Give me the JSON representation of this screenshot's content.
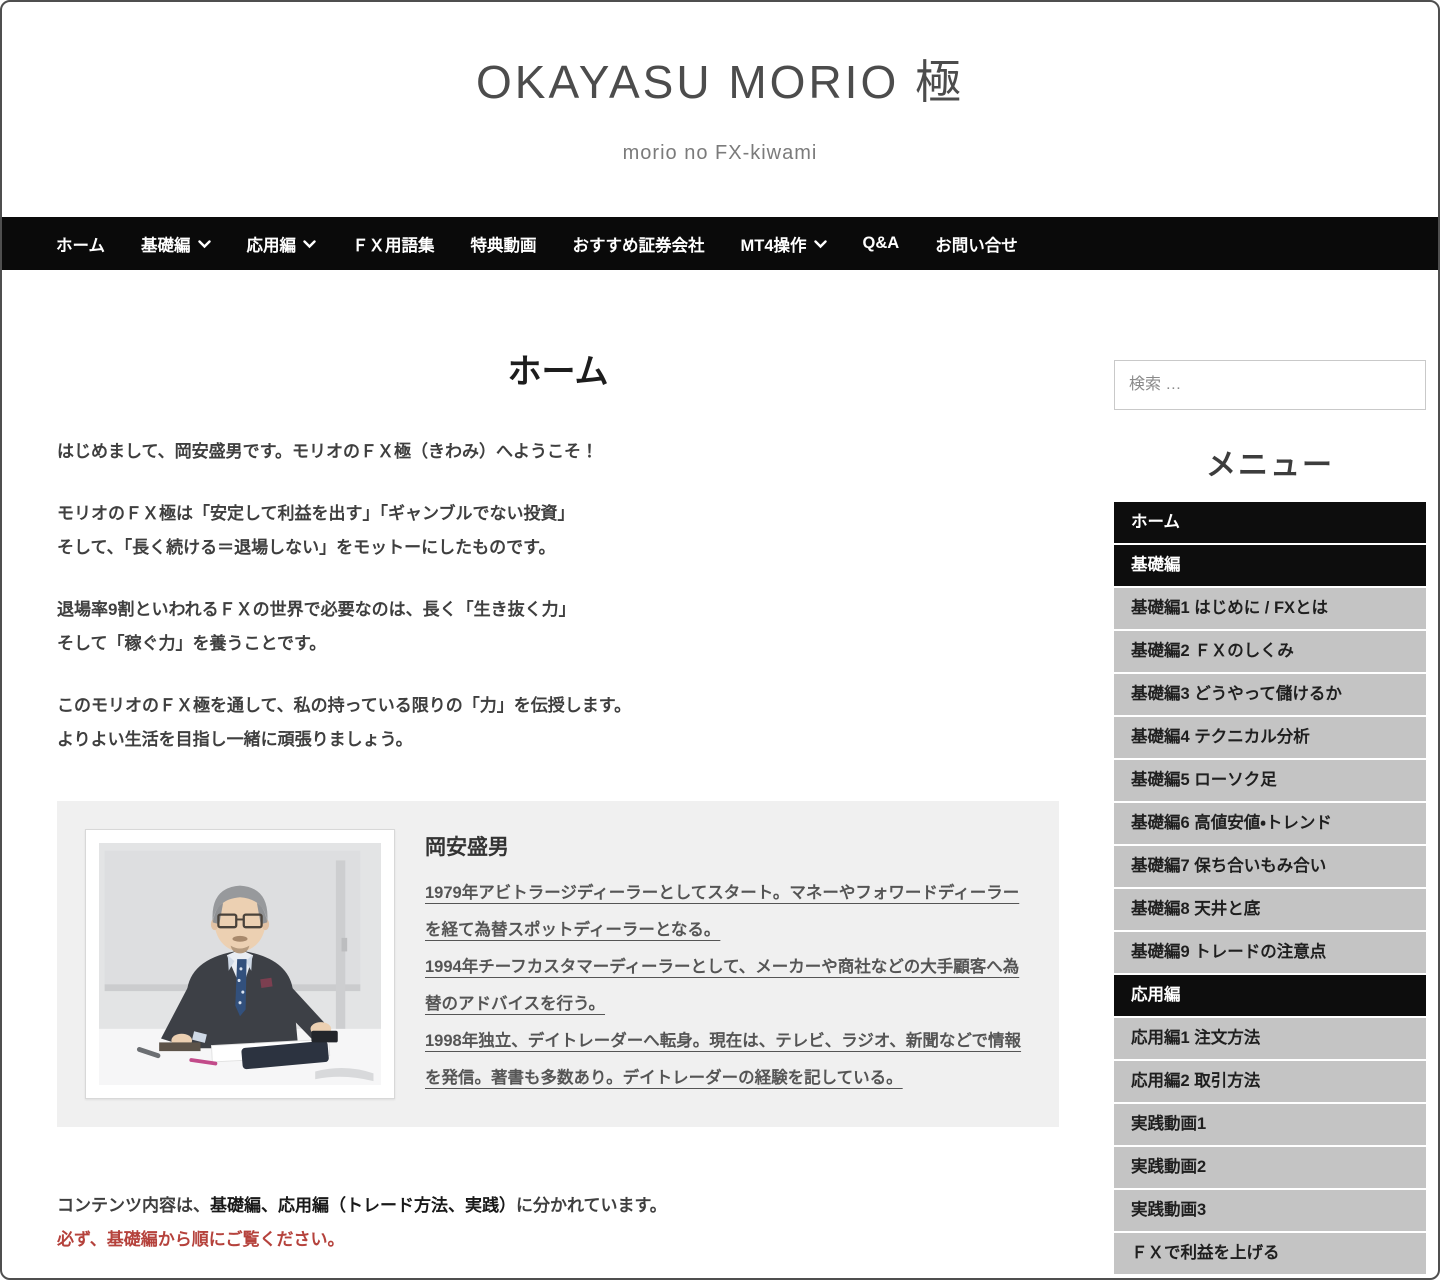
{
  "page": {
    "title": "OKAYASU MORIO 極",
    "subtitle": "morio no FX-kiwami"
  },
  "nav": {
    "items": [
      {
        "label": "ホーム",
        "has_dropdown": false,
        "current": true
      },
      {
        "label": "基礎編",
        "has_dropdown": true
      },
      {
        "label": "応用編",
        "has_dropdown": true
      },
      {
        "label": "ＦＸ用語集",
        "has_dropdown": false
      },
      {
        "label": "特典動画",
        "has_dropdown": false
      },
      {
        "label": "おすすめ証券会社",
        "has_dropdown": false
      },
      {
        "label": "MT4操作",
        "has_dropdown": true
      },
      {
        "label": "Q&A",
        "has_dropdown": false
      },
      {
        "label": "お問い合せ",
        "has_dropdown": false
      }
    ]
  },
  "main": {
    "heading": "ホーム",
    "paragraphs": [
      "はじめまして、岡安盛男です。モリオのＦＸ極（きわみ）へようこそ！",
      "モリオのＦＸ極は「安定して利益を出す」「ギャンブルでない投資」\nそして、「長く続ける＝退場しない」をモットーにしたものです。",
      "退場率9割といわれるＦＸの世界で必要なのは、長く「生き抜く力」\nそして「稼ぐ力」を養うことです。",
      "このモリオのＦＸ極を通して、私の持っている限りの「力」を伝授します。\nよりよい生活を目指し一緒に頑張りましょう。"
    ],
    "profile": {
      "name": "岡安盛男",
      "photo_description": "man-in-suit-at-desk-photo",
      "bio": [
        "1979年アビトラージディーラーとしてスタート。マネーやフォワードディーラーを経て為替スポットディーラーとなる。",
        "1994年チーフカスタマーディーラーとして、メーカーや商社などの大手顧客へ為替のアドバイスを行う。",
        "1998年独立、デイトレーダーへ転身。現在は、テレビ、ラジオ、新聞などで情報を発信。著書も多数あり。デイトレーダーの経験を記している。"
      ]
    },
    "footer_note": {
      "prefix": "コンテンツ内容は、",
      "bold": "基礎編、応用編（トレード方法、実践）",
      "suffix": "に分かれています。",
      "warning": "必ず、基礎編から順にご覧ください。"
    }
  },
  "sidebar": {
    "search_placeholder": "検索 …",
    "menu_heading": "メニュー",
    "menu_items": [
      {
        "label": "ホーム",
        "style": "dark"
      },
      {
        "label": "基礎編",
        "style": "dark"
      },
      {
        "label": "基礎編1 はじめに / FXとは",
        "style": "light"
      },
      {
        "label": "基礎編2 ＦＸのしくみ",
        "style": "light"
      },
      {
        "label": "基礎編3 どうやって儲けるか",
        "style": "light"
      },
      {
        "label": "基礎編4 テクニカル分析",
        "style": "light"
      },
      {
        "label": "基礎編5 ローソク足",
        "style": "light"
      },
      {
        "label": "基礎編6 高値安値・トレンド",
        "style": "light"
      },
      {
        "label": "基礎編7 保ち合いもみ合い",
        "style": "light"
      },
      {
        "label": "基礎編8 天井と底",
        "style": "light"
      },
      {
        "label": "基礎編9 トレードの注意点",
        "style": "light"
      },
      {
        "label": "応用編",
        "style": "dark"
      },
      {
        "label": "応用編1 注文方法",
        "style": "light"
      },
      {
        "label": "応用編2 取引方法",
        "style": "light"
      },
      {
        "label": "実践動画1",
        "style": "light"
      },
      {
        "label": "実践動画2",
        "style": "light"
      },
      {
        "label": "実践動画3",
        "style": "light"
      },
      {
        "label": "ＦＸで利益を上げる",
        "style": "light"
      }
    ]
  },
  "colors": {
    "nav_bg": "#0a0a0a",
    "menu_dark_bg": "#0d0d0d",
    "menu_light_bg": "#c4c4c4",
    "profile_box_bg": "#f0f0f0",
    "warning_red": "#b5423c",
    "page_border": "#4f4f4f"
  }
}
